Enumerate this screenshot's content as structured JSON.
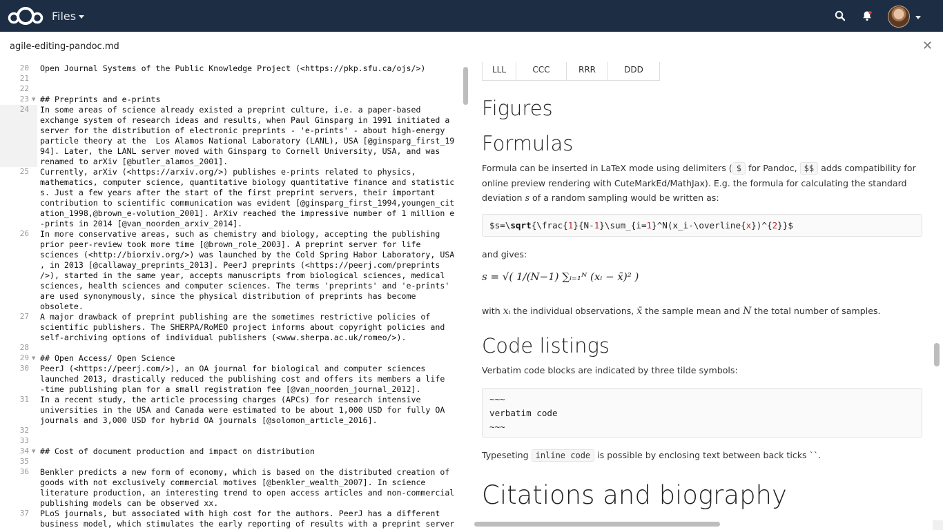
{
  "topbar": {
    "app_name": "Files",
    "icons": {
      "logo": "cloud-logo-icon",
      "search": "search-icon",
      "notifications": "bell-icon",
      "account": "avatar"
    }
  },
  "file": {
    "name": "agile-editing-pandoc.md"
  },
  "editor": {
    "lines": [
      {
        "n": "20",
        "t": "Open Journal Systems of the Public Knowledge Project (<https://pkp.sfu.ca/ojs/>)"
      },
      {
        "n": "21",
        "t": ""
      },
      {
        "n": "22",
        "t": ""
      },
      {
        "n": "23",
        "t": "## Preprints and e-prints",
        "fold": true
      },
      {
        "n": "24",
        "t": "In some areas of science already existed a preprint culture, i.e. a paper-based",
        "active": true
      },
      {
        "n": "",
        "t": "exchange system of research ideas and results, when Paul Ginsparg in 1991 initiated a",
        "active": true
      },
      {
        "n": "",
        "t": "server for the distribution of electronic preprints - 'e-prints' - about high-energy",
        "active": true
      },
      {
        "n": "",
        "t": "particle theory at the  Los Alamos National Laboratory (LANL), USA [@ginsparg_first_19",
        "active": true
      },
      {
        "n": "",
        "t": "94]. Later, the LANL server moved with Ginsparg to Cornell University, USA, and was",
        "active": true
      },
      {
        "n": "",
        "t": "renamed to arXiv [@butler_alamos_2001].",
        "active": true
      },
      {
        "n": "25",
        "t": "Currently, arXiv (<https://arxiv.org/>) publishes e-prints related to physics,"
      },
      {
        "n": "",
        "t": "mathematics, computer science, quantitative biology quantitative finance and statistic"
      },
      {
        "n": "",
        "t": "s. Just a few years after the start of the first preprint servers, their important"
      },
      {
        "n": "",
        "t": "contribution to scientific communication was evident [@ginsparg_first_1994,youngen_cit"
      },
      {
        "n": "",
        "t": "ation_1998,@brown_e-volution_2001]. ArXiv reached the impressive number of 1 million e"
      },
      {
        "n": "",
        "t": "-prints in 2014 [@van_noorden_arxiv_2014]."
      },
      {
        "n": "26",
        "t": "In more conservative areas, such as chemistry and biology, accepting the publishing"
      },
      {
        "n": "",
        "t": "prior peer-review took more time [@brown_role_2003]. A preprint server for life"
      },
      {
        "n": "",
        "t": "sciences (<http://biorxiv.org/>) was launched by the Cold Spring Habor Laboratory, USA"
      },
      {
        "n": "",
        "t": ", in 2013 [@callaway_preprints_2013]. PeerJ preprints (<https://peerj.com/preprints"
      },
      {
        "n": "",
        "t": "/>), started in the same year, accepts manuscripts from biological sciences, medical"
      },
      {
        "n": "",
        "t": "sciences, health sciences and computer sciences. The terms 'preprints' and 'e-prints'"
      },
      {
        "n": "",
        "t": "are used synonymously, since the physical distribution of preprints has become"
      },
      {
        "n": "",
        "t": "obsolete."
      },
      {
        "n": "27",
        "t": "A major drawback of preprint publishing are the sometimes restrictive policies of"
      },
      {
        "n": "",
        "t": "scientific publishers. The SHERPA/RoMEO project informs about copyright policies and"
      },
      {
        "n": "",
        "t": "self-archiving options of individual publishers (<www.sherpa.ac.uk/romeo/>)."
      },
      {
        "n": "28",
        "t": ""
      },
      {
        "n": "29",
        "t": "## Open Access/ Open Science",
        "fold": true
      },
      {
        "n": "30",
        "t": "PeerJ (<https://peerj.com/>), an OA journal for biological and computer sciences"
      },
      {
        "n": "",
        "t": "launched 2013, drastically reduced the publishing cost and offers its members a life"
      },
      {
        "n": "",
        "t": "-time publishing plan for a small registration fee [@van_noorden_journal_2012]."
      },
      {
        "n": "31",
        "t": "In a recent study, the article processing charges (APCs) for research intensive"
      },
      {
        "n": "",
        "t": "universities in the USA and Canada were estimated to be about 1,000 USD for fully OA"
      },
      {
        "n": "",
        "t": "journals and 3,000 USD for hybrid OA journals [@solomon_article_2016]."
      },
      {
        "n": "32",
        "t": ""
      },
      {
        "n": "33",
        "t": ""
      },
      {
        "n": "34",
        "t": "## Cost of document production and impact on distribution",
        "fold": true
      },
      {
        "n": "35",
        "t": ""
      },
      {
        "n": "36",
        "t": "Benkler predicts a new form of economy, which is based on the distributed creation of"
      },
      {
        "n": "",
        "t": "goods with not exclusively commercial motives [@benkler_wealth_2007]. In science"
      },
      {
        "n": "",
        "t": "literature production, an interesting trend to open access articles and non-commercial"
      },
      {
        "n": "",
        "t": "publishing models can be observed xx."
      },
      {
        "n": "37",
        "t": "PLoS journals, but associated with high cost for the authors. PeerJ has a different"
      },
      {
        "n": "",
        "t": "business model, which stimulates the early reporting of results with a preprint server"
      }
    ]
  },
  "preview": {
    "table_cells": [
      "LLL",
      "CCC",
      "RRR",
      "DDD"
    ],
    "h_figures": "Figures",
    "h_formulas": "Formulas",
    "formula_para": {
      "a": "Formula can be inserted in LaTeX mode using delimiters (",
      "code1": "$",
      "b": "for Pandoc,",
      "code2": "$$",
      "c": "adds compatibility for online preview rendering with CuteMarkEd/MathJax). E.g. the formula for calculating the standard deviation",
      "var": "s",
      "d": "of a random sampling would be written as:"
    },
    "formula_source": "$s=\\sqrt{\\frac{1}{N-1}\\sum_{i=1}^N(x_i-\\overline{x})^{2}}$",
    "and_gives": "and gives:",
    "rendered_formula": "s = √( 1/(N−1) ∑ᵢ₌₁ᴺ (xᵢ − x̄)² )",
    "with_para": {
      "a": "with",
      "xi": "xᵢ",
      "b": "the individual observations,",
      "xbar": "x̄",
      "c": "the sample mean and",
      "N": "N",
      "d": "the total number of samples."
    },
    "h_code": "Code listings",
    "verbatim_para": "Verbatim code blocks are indicated by three tilde symbols:",
    "code_lines": [
      "~~~",
      "verbatim code",
      "~~~"
    ],
    "inline_para": {
      "a": "Typeseting",
      "code": "inline code",
      "b": "is possible by enclosing text between back ticks ``."
    },
    "h_citations": "Citations and biography"
  }
}
